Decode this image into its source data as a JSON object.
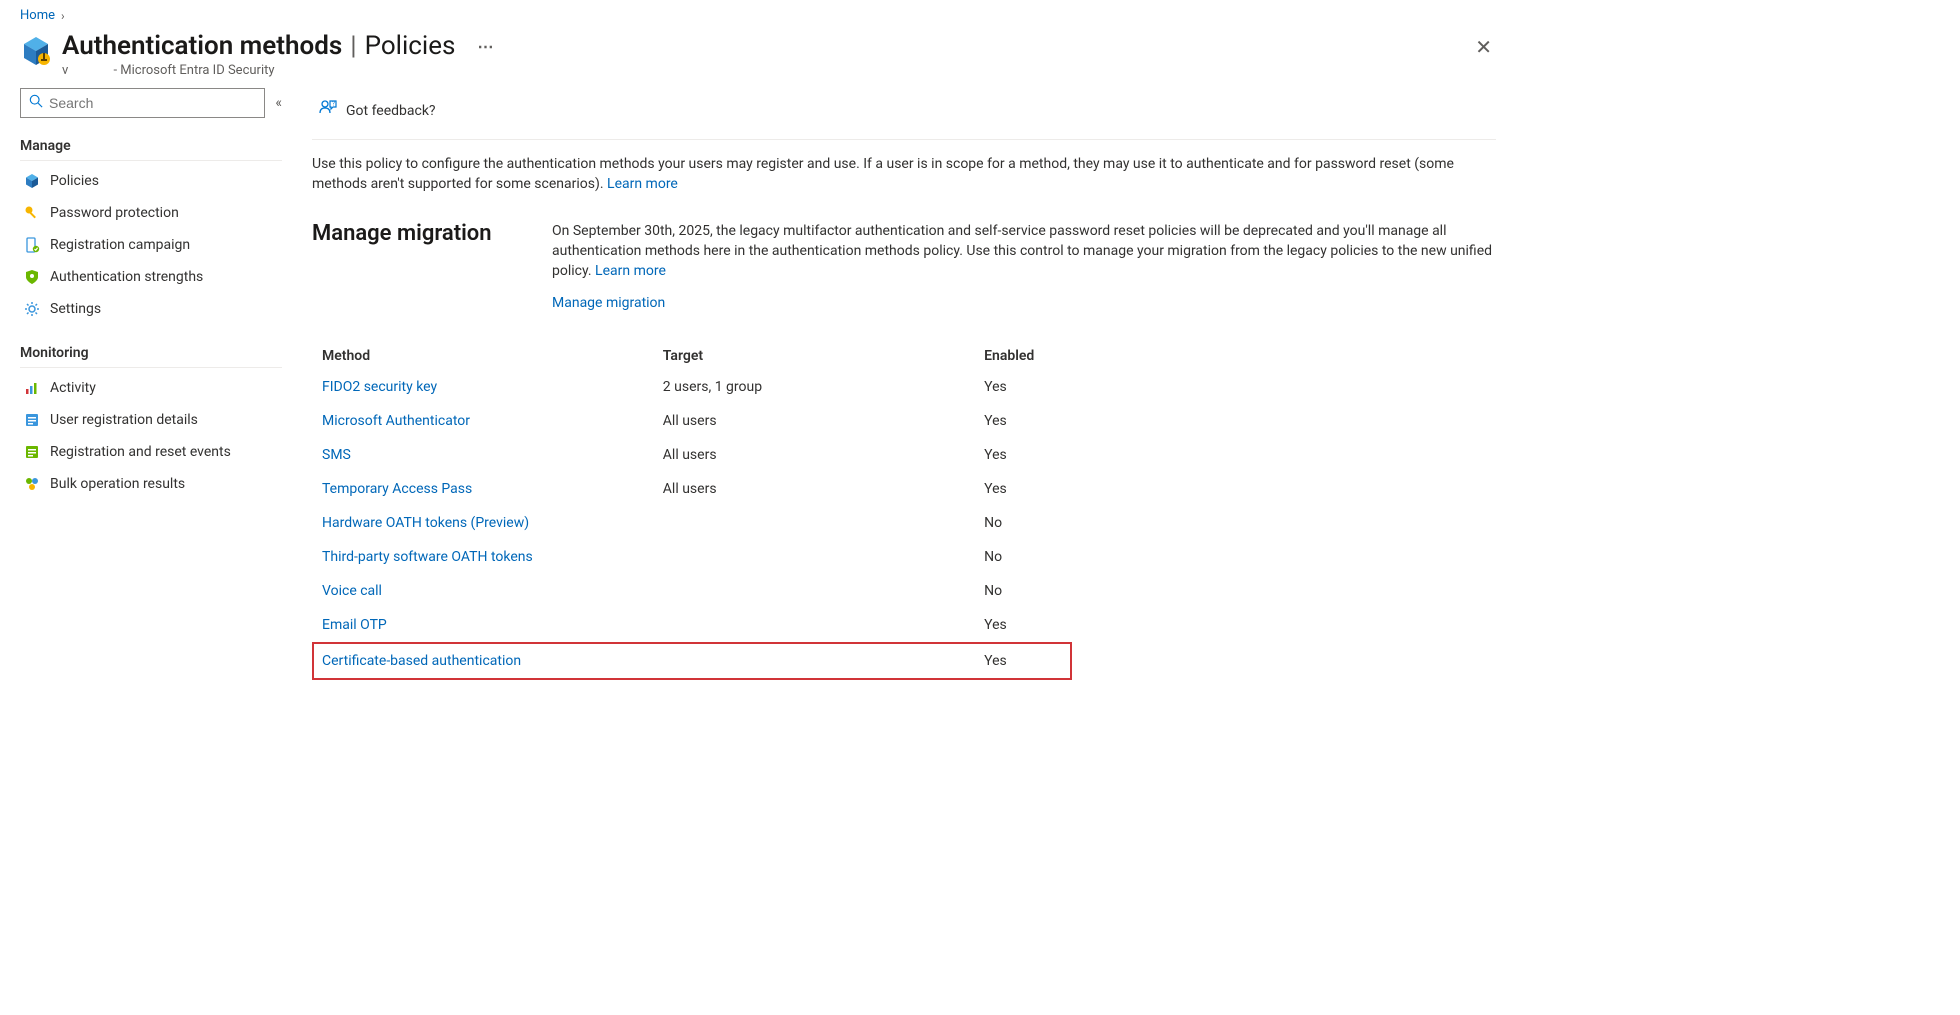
{
  "breadcrumb": {
    "home": "Home"
  },
  "header": {
    "title_main": "Authentication methods",
    "title_sub": "Policies",
    "org_prefix": "v",
    "org_suffix": "- Microsoft Entra ID Security"
  },
  "sidebar": {
    "search_placeholder": "Search",
    "groups": [
      {
        "label": "Manage",
        "items": [
          {
            "icon": "policies-icon",
            "label": "Policies"
          },
          {
            "icon": "key-icon",
            "label": "Password protection"
          },
          {
            "icon": "campaign-icon",
            "label": "Registration campaign"
          },
          {
            "icon": "shield-icon",
            "label": "Authentication strengths"
          },
          {
            "icon": "gear-icon",
            "label": "Settings"
          }
        ]
      },
      {
        "label": "Monitoring",
        "items": [
          {
            "icon": "activity-icon",
            "label": "Activity"
          },
          {
            "icon": "details-icon",
            "label": "User registration details"
          },
          {
            "icon": "events-icon",
            "label": "Registration and reset events"
          },
          {
            "icon": "bulk-icon",
            "label": "Bulk operation results"
          }
        ]
      }
    ]
  },
  "toolbar": {
    "feedback": "Got feedback?"
  },
  "intro": {
    "text": "Use this policy to configure the authentication methods your users may register and use. If a user is in scope for a method, they may use it to authenticate and for password reset (some methods aren't supported for some scenarios). ",
    "learn_more": "Learn more"
  },
  "migration": {
    "title": "Manage migration",
    "text": "On September 30th, 2025, the legacy multifactor authentication and self-service password reset policies will be deprecated and you'll manage all authentication methods here in the authentication methods policy. Use this control to manage your migration from the legacy policies to the new unified policy. ",
    "learn_more": "Learn more",
    "manage_link": "Manage migration"
  },
  "table": {
    "headers": {
      "method": "Method",
      "target": "Target",
      "enabled": "Enabled"
    },
    "rows": [
      {
        "method": "FIDO2 security key",
        "target": "2 users, 1 group",
        "enabled": "Yes",
        "highlighted": false
      },
      {
        "method": "Microsoft Authenticator",
        "target": "All users",
        "enabled": "Yes",
        "highlighted": false
      },
      {
        "method": "SMS",
        "target": "All users",
        "enabled": "Yes",
        "highlighted": false
      },
      {
        "method": "Temporary Access Pass",
        "target": "All users",
        "enabled": "Yes",
        "highlighted": false
      },
      {
        "method": "Hardware OATH tokens (Preview)",
        "target": "",
        "enabled": "No",
        "highlighted": false
      },
      {
        "method": "Third-party software OATH tokens",
        "target": "",
        "enabled": "No",
        "highlighted": false
      },
      {
        "method": "Voice call",
        "target": "",
        "enabled": "No",
        "highlighted": false
      },
      {
        "method": "Email OTP",
        "target": "",
        "enabled": "Yes",
        "highlighted": false
      },
      {
        "method": "Certificate-based authentication",
        "target": "",
        "enabled": "Yes",
        "highlighted": true
      }
    ]
  }
}
